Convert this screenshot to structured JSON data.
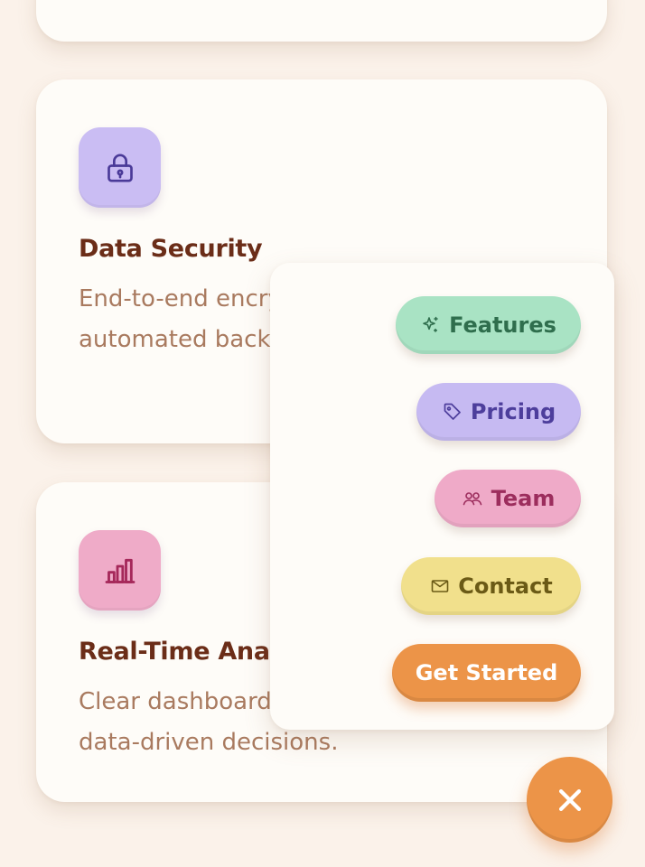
{
  "cards": [
    {
      "title": "Data Security",
      "description": "End-to-end encryption, compliance, and automated backups.",
      "icon": "lock-icon",
      "icon_color": "#cabdf3"
    },
    {
      "title": "Real-Time Analytics",
      "description": "Clear dashboards that help you make data-driven decisions.",
      "icon": "bar-chart-icon",
      "icon_color": "#efabc8"
    }
  ],
  "menu": {
    "items": [
      {
        "label": "Features",
        "icon": "sparkle-icon",
        "color": "#a9e3c4"
      },
      {
        "label": "Pricing",
        "icon": "tag-icon",
        "color": "#c6baf2"
      },
      {
        "label": "Team",
        "icon": "users-icon",
        "color": "#efaac8"
      },
      {
        "label": "Contact",
        "icon": "mail-icon",
        "color": "#f1e08c"
      }
    ],
    "cta": {
      "label": "Get Started",
      "color": "#ec9448"
    }
  },
  "fab": {
    "icon": "close-icon",
    "color": "#ec9448"
  },
  "colors": {
    "background": "#fbf2ea",
    "card": "#fefcf8",
    "title": "#6b2d18",
    "body_text": "#a97a5f"
  }
}
